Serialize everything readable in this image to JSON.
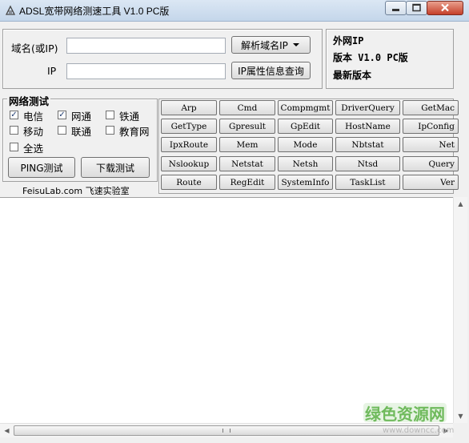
{
  "window": {
    "title": "ADSL宽带网络测速工具 V1.0 PC版"
  },
  "domain_query": {
    "domain_label": "域名(或IP)",
    "domain_value": "",
    "resolve_button": "解析域名IP",
    "ip_label": "IP",
    "ip_value": "",
    "ipinfo_button": "IP属性信息查询"
  },
  "info": {
    "external_ip": "外网IP",
    "version": "版本 V1.0 PC版",
    "latest": "最新版本"
  },
  "network_test": {
    "title": "网络测试",
    "isps": [
      {
        "label": "电信",
        "checked": true
      },
      {
        "label": "网通",
        "checked": true
      },
      {
        "label": "铁通",
        "checked": false
      },
      {
        "label": "移动",
        "checked": false
      },
      {
        "label": "联通",
        "checked": false
      },
      {
        "label": "教育网",
        "checked": false
      }
    ],
    "select_all": {
      "label": "全选",
      "checked": false
    },
    "ping_button": "PING测试",
    "download_button": "下载测试",
    "footer": "FeisuLab.com 飞速实验室"
  },
  "commands": [
    [
      "Arp",
      "Cmd",
      "Compmgmt",
      "DriverQuery",
      "GetMac"
    ],
    [
      "GetType",
      "Gpresult",
      "GpEdit",
      "HostName",
      "IpConfig"
    ],
    [
      "IpxRoute",
      "Mem",
      "Mode",
      "Nbtstat",
      "Net"
    ],
    [
      "Nslookup",
      "Netstat",
      "Netsh",
      "Ntsd",
      "Query"
    ],
    [
      "Route",
      "RegEdit",
      "SystemInfo",
      "TaskList",
      "Ver"
    ]
  ],
  "watermark": {
    "brand": "绿色资源网",
    "url": "www.downcc.com"
  },
  "icons": {
    "check": "check-icon",
    "dropdown": "dropdown-arrow-icon"
  }
}
